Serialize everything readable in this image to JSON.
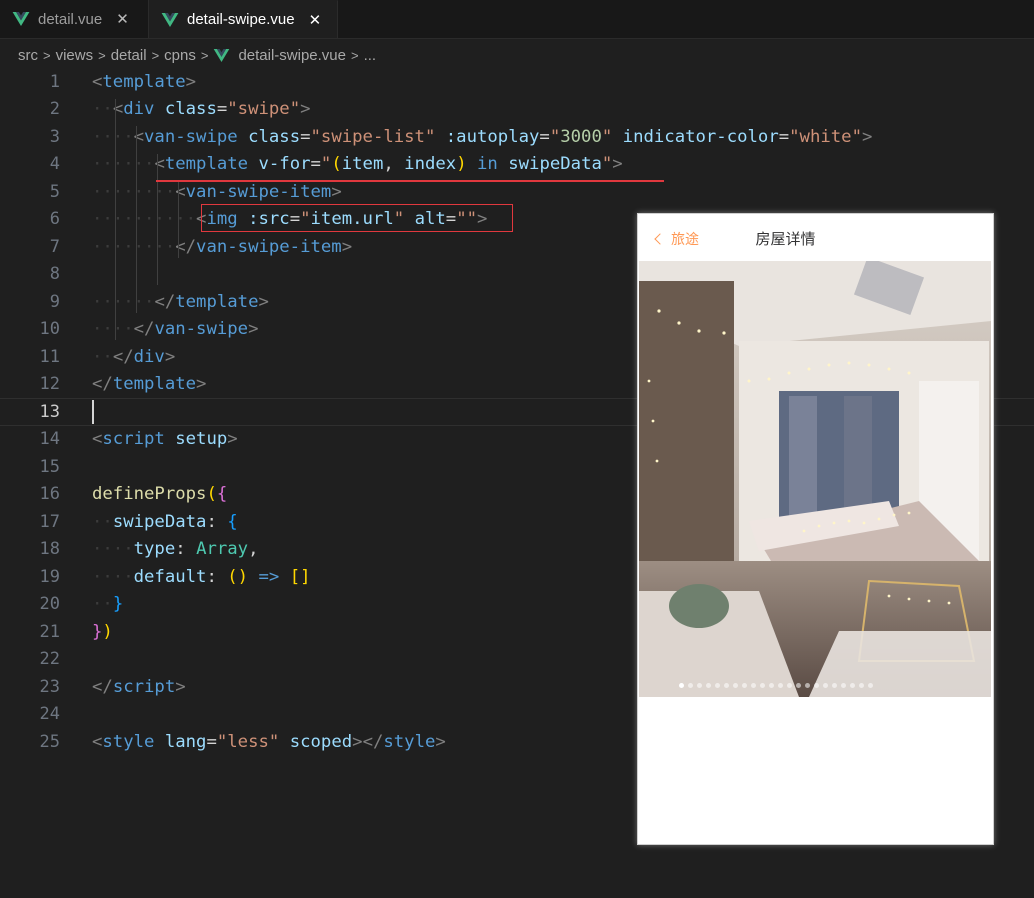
{
  "tabs": [
    {
      "label": "detail.vue",
      "active": false
    },
    {
      "label": "detail-swipe.vue",
      "active": true
    }
  ],
  "breadcrumb": [
    "src",
    "views",
    "detail",
    "cpns",
    "detail-swipe.vue",
    "..."
  ],
  "active_line": 13,
  "lines": [
    {
      "n": "1"
    },
    {
      "n": "2"
    },
    {
      "n": "3"
    },
    {
      "n": "4"
    },
    {
      "n": "5"
    },
    {
      "n": "6"
    },
    {
      "n": "7"
    },
    {
      "n": "8"
    },
    {
      "n": "9"
    },
    {
      "n": "10"
    },
    {
      "n": "11"
    },
    {
      "n": "12"
    },
    {
      "n": "13"
    },
    {
      "n": "14"
    },
    {
      "n": "15"
    },
    {
      "n": "16"
    },
    {
      "n": "17"
    },
    {
      "n": "18"
    },
    {
      "n": "19"
    },
    {
      "n": "20"
    },
    {
      "n": "21"
    },
    {
      "n": "22"
    },
    {
      "n": "23"
    },
    {
      "n": "24"
    },
    {
      "n": "25"
    }
  ],
  "code": {
    "l1": [
      [
        "<",
        "p"
      ],
      [
        "template",
        "tag"
      ],
      [
        ">",
        "p"
      ]
    ],
    "l2": [
      [
        "<",
        "p"
      ],
      [
        "div",
        "tag"
      ],
      [
        " ",
        "plain"
      ],
      [
        "class",
        "attr"
      ],
      [
        "=",
        "plain"
      ],
      [
        "\"swipe\"",
        "str"
      ],
      [
        ">",
        "p"
      ]
    ],
    "l3": [
      [
        "<",
        "p"
      ],
      [
        "van-swipe",
        "tag"
      ],
      [
        " ",
        "plain"
      ],
      [
        "class",
        "attr"
      ],
      [
        "=",
        "plain"
      ],
      [
        "\"swipe-list\"",
        "str"
      ],
      [
        " ",
        "plain"
      ],
      [
        ":autoplay",
        "attr"
      ],
      [
        "=",
        "plain"
      ],
      [
        "\"",
        "str"
      ],
      [
        "3000",
        "num"
      ],
      [
        "\"",
        "str"
      ],
      [
        " ",
        "plain"
      ],
      [
        "indicator-color",
        "attr"
      ],
      [
        "=",
        "plain"
      ],
      [
        "\"white\"",
        "str"
      ],
      [
        ">",
        "p"
      ]
    ],
    "l4": [
      [
        "<",
        "p"
      ],
      [
        "template",
        "tag"
      ],
      [
        " ",
        "plain"
      ],
      [
        "v-for",
        "attr"
      ],
      [
        "=",
        "plain"
      ],
      [
        "\"",
        "str"
      ],
      [
        "(",
        "brk1"
      ],
      [
        "item",
        "attr"
      ],
      [
        ", ",
        "plain"
      ],
      [
        "index",
        "attr"
      ],
      [
        ")",
        "brk1"
      ],
      [
        " ",
        "plain"
      ],
      [
        "in",
        "kw"
      ],
      [
        " ",
        "plain"
      ],
      [
        "swipeData",
        "attr"
      ],
      [
        "\"",
        "str"
      ],
      [
        ">",
        "p"
      ]
    ],
    "l5": [
      [
        "<",
        "p"
      ],
      [
        "van-swipe-item",
        "tag"
      ],
      [
        ">",
        "p"
      ]
    ],
    "l6": [
      [
        "<",
        "p"
      ],
      [
        "img",
        "tag"
      ],
      [
        " ",
        "plain"
      ],
      [
        ":src",
        "attr"
      ],
      [
        "=",
        "plain"
      ],
      [
        "\"",
        "str"
      ],
      [
        "item.url",
        "attr"
      ],
      [
        "\"",
        "str"
      ],
      [
        " ",
        "plain"
      ],
      [
        "alt",
        "attr"
      ],
      [
        "=",
        "plain"
      ],
      [
        "\"\"",
        "str"
      ],
      [
        ">",
        "p"
      ]
    ],
    "l7": [
      [
        "</",
        "p"
      ],
      [
        "van-swipe-item",
        "tag"
      ],
      [
        ">",
        "p"
      ]
    ],
    "l8": [],
    "l9": [
      [
        "</",
        "p"
      ],
      [
        "template",
        "tag"
      ],
      [
        ">",
        "p"
      ]
    ],
    "l10": [
      [
        "</",
        "p"
      ],
      [
        "van-swipe",
        "tag"
      ],
      [
        ">",
        "p"
      ]
    ],
    "l11": [
      [
        "</",
        "p"
      ],
      [
        "div",
        "tag"
      ],
      [
        ">",
        "p"
      ]
    ],
    "l12": [
      [
        "</",
        "p"
      ],
      [
        "template",
        "tag"
      ],
      [
        ">",
        "p"
      ]
    ],
    "l13": [],
    "l14": [
      [
        "<",
        "p"
      ],
      [
        "script",
        "tag"
      ],
      [
        " ",
        "plain"
      ],
      [
        "setup",
        "attr"
      ],
      [
        ">",
        "p"
      ]
    ],
    "l15": [],
    "l16": [
      [
        "defineProps",
        "fn"
      ],
      [
        "(",
        "brk1"
      ],
      [
        "{",
        "brk2"
      ]
    ],
    "l17": [
      [
        "swipeData",
        "attr"
      ],
      [
        ": ",
        "plain"
      ],
      [
        "{",
        "brk3"
      ]
    ],
    "l18": [
      [
        "type",
        "attr"
      ],
      [
        ": ",
        "plain"
      ],
      [
        "Array",
        "type"
      ],
      [
        ",",
        "plain"
      ]
    ],
    "l19": [
      [
        "default",
        "attr"
      ],
      [
        ": ",
        "plain"
      ],
      [
        "()",
        "brk1"
      ],
      [
        " ",
        "plain"
      ],
      [
        "=>",
        "kw"
      ],
      [
        " ",
        "plain"
      ],
      [
        "[]",
        "brk1"
      ]
    ],
    "l20": [
      [
        "}",
        "brk3"
      ]
    ],
    "l21": [
      [
        "}",
        "brk2"
      ],
      [
        ")",
        "brk1"
      ]
    ],
    "l22": [],
    "l23": [
      [
        "</",
        "p"
      ],
      [
        "script",
        "tag"
      ],
      [
        ">",
        "p"
      ]
    ],
    "l24": [],
    "l25": [
      [
        "<",
        "p"
      ],
      [
        "style",
        "tag"
      ],
      [
        " ",
        "plain"
      ],
      [
        "lang",
        "attr"
      ],
      [
        "=",
        "plain"
      ],
      [
        "\"less\"",
        "str"
      ],
      [
        " ",
        "plain"
      ],
      [
        "scoped",
        "attr"
      ],
      [
        ">",
        "p"
      ],
      [
        "</",
        "p"
      ],
      [
        "style",
        "tag"
      ],
      [
        ">",
        "p"
      ]
    ]
  },
  "preview": {
    "back_label": "旅途",
    "title": "房屋详情",
    "indicator_count": 22,
    "indicator_active": 0
  },
  "colors": {
    "accent_orange": "#ff9854",
    "annotation_red": "#e0383e",
    "vue_green": "#41b883"
  }
}
